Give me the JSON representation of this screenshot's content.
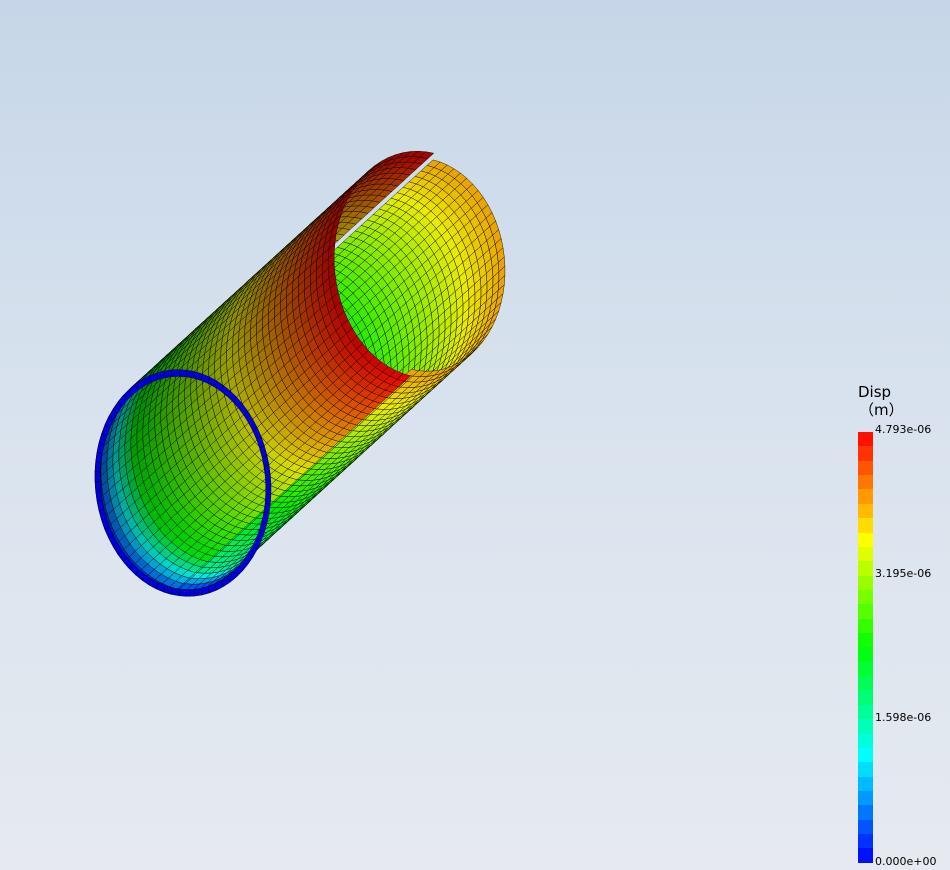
{
  "legend": {
    "title": "Disp",
    "unit": "（m）",
    "ticks": [
      {
        "label": "4.793e-06",
        "value": 4.793e-06
      },
      {
        "label": "3.195e-06",
        "value": 3.195e-06
      },
      {
        "label": "1.598e-06",
        "value": 1.598e-06
      },
      {
        "label": "0.000e+00",
        "value": 0.0
      }
    ],
    "range": [
      0.0,
      4.793e-06
    ],
    "colormap": [
      "#0000ff",
      "#00ffff",
      "#00ff00",
      "#ffff00",
      "#ff0000"
    ]
  },
  "colors": {
    "background_top": "#c6d6e8",
    "background_bottom": "#e6eaf0",
    "mesh_lines": "#000000"
  }
}
